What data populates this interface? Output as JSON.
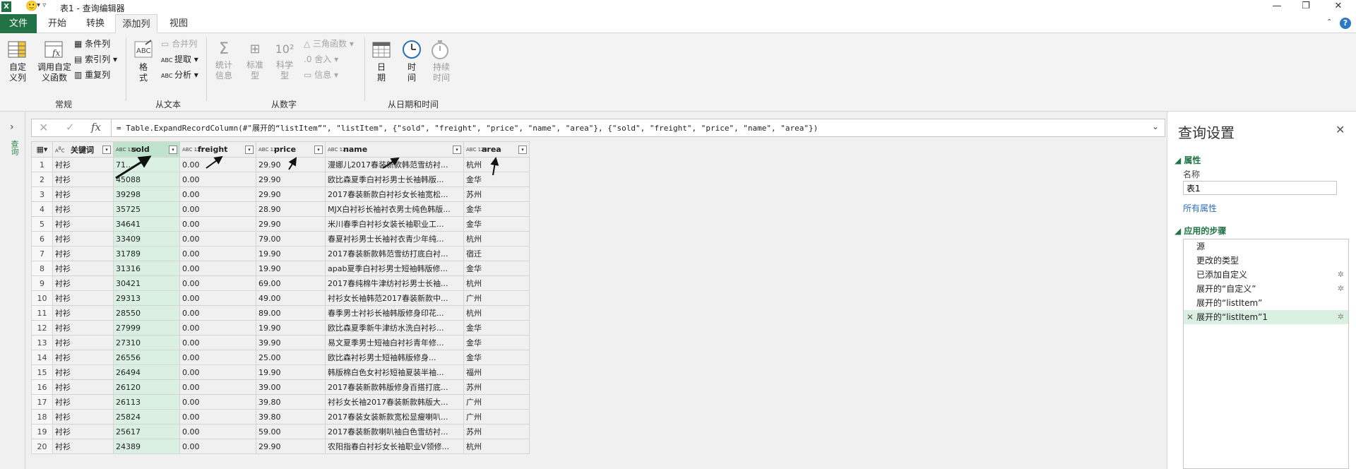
{
  "window": {
    "title": "表1 - 查询编辑器",
    "app_badge": "X",
    "smile": "🙂",
    "qat_arrows": "▾ ▿"
  },
  "tabs": [
    {
      "label": "文件"
    },
    {
      "label": "开始"
    },
    {
      "label": "转换"
    },
    {
      "label": "添加列"
    },
    {
      "label": "视图"
    }
  ],
  "ribbon": {
    "general": {
      "group_label": "常规",
      "custom_column": "自定\n义列",
      "invoke_custom_function": "调用自定\n义函数",
      "conditional_column": "条件列",
      "index_column": "索引列",
      "duplicate_column": "重复列"
    },
    "from_text": {
      "group_label": "从文本",
      "format": "格\n式",
      "merge_columns": "合并列",
      "extract": "提取",
      "parse": "分析"
    },
    "from_number": {
      "group_label": "从数字",
      "statistics": "统计\n信息",
      "standard": "标准\n型",
      "scientific": "科学\n型",
      "trig": "三角函数",
      "rounding": "舍入",
      "information": "信息"
    },
    "from_datetime": {
      "group_label": "从日期和时间",
      "date": "日\n期",
      "time": "时\n间",
      "duration": "持续\n时间"
    }
  },
  "left_pane": {
    "label": "查询"
  },
  "formula": {
    "text": "= Table.ExpandRecordColumn(#\"展开的“listItem”\", \"listItem\", {\"sold\", \"freight\", \"price\", \"name\", \"area\"}, {\"sold\", \"freight\", \"price\", \"name\", \"area\"})"
  },
  "grid": {
    "columns": [
      {
        "name": "关键词",
        "type": "ABC"
      },
      {
        "name": "sold",
        "type": "ABC123"
      },
      {
        "name": "freight",
        "type": "ABC123"
      },
      {
        "name": "price",
        "type": "ABC123"
      },
      {
        "name": "name",
        "type": "ABC123"
      },
      {
        "name": "area",
        "type": "ABC123"
      }
    ],
    "rows": [
      [
        "1",
        "衬衫",
        "71...",
        "0.00",
        "29.90",
        "漫娜儿2017春装新款韩范雪纺衬...",
        "杭州"
      ],
      [
        "2",
        "衬衫",
        "45088",
        "0.00",
        "29.90",
        "欧比森夏季白衬衫男士长袖韩版...",
        "金华"
      ],
      [
        "3",
        "衬衫",
        "39298",
        "0.00",
        "29.90",
        "2017春装新款白衬衫女长袖宽松...",
        "苏州"
      ],
      [
        "4",
        "衬衫",
        "35725",
        "0.00",
        "28.90",
        "MJX白衬衫长袖衬衣男士纯色韩版...",
        "金华"
      ],
      [
        "5",
        "衬衫",
        "34641",
        "0.00",
        "29.90",
        "米川春季白衬衫女装长袖职业工...",
        "金华"
      ],
      [
        "6",
        "衬衫",
        "33409",
        "0.00",
        "79.00",
        "春夏衬衫男士长袖衬衣青少年纯...",
        "杭州"
      ],
      [
        "7",
        "衬衫",
        "31789",
        "0.00",
        "19.90",
        "2017春装新款韩范雪纺打底白衬...",
        "宿迁"
      ],
      [
        "8",
        "衬衫",
        "31316",
        "0.00",
        "19.90",
        "apab夏季白衬衫男士短袖韩版修...",
        "金华"
      ],
      [
        "9",
        "衬衫",
        "30421",
        "0.00",
        "69.00",
        "2017春纯棉牛津纺衬衫男士长袖...",
        "杭州"
      ],
      [
        "10",
        "衬衫",
        "29313",
        "0.00",
        "49.00",
        "衬衫女长袖韩范2017春装新款中...",
        "广州"
      ],
      [
        "11",
        "衬衫",
        "28550",
        "0.00",
        "89.00",
        "春季男士衬衫长袖韩版修身印花...",
        "杭州"
      ],
      [
        "12",
        "衬衫",
        "27999",
        "0.00",
        "19.90",
        "欧比森夏季新牛津纺水洗白衬衫...",
        "金华"
      ],
      [
        "13",
        "衬衫",
        "27310",
        "0.00",
        "39.90",
        "易文夏季男士短袖白衬衫青年修...",
        "金华"
      ],
      [
        "14",
        "衬衫",
        "26556",
        "0.00",
        "25.00",
        "欧比森衬衫男士短袖韩版修身...",
        "金华"
      ],
      [
        "15",
        "衬衫",
        "26494",
        "0.00",
        "19.90",
        "韩版棉白色女衬衫短袖夏装半袖...",
        "福州"
      ],
      [
        "16",
        "衬衫",
        "26120",
        "0.00",
        "39.00",
        "2017春装新款韩版修身百搭打底...",
        "苏州"
      ],
      [
        "17",
        "衬衫",
        "26113",
        "0.00",
        "39.80",
        "衬衫女长袖2017春装新款韩版大...",
        "广州"
      ],
      [
        "18",
        "衬衫",
        "25824",
        "0.00",
        "39.80",
        "2017春装女装新款宽松显瘦喇叭...",
        "广州"
      ],
      [
        "19",
        "衬衫",
        "25617",
        "0.00",
        "59.00",
        "2017春装新款喇叭袖白色雪纺衬...",
        "苏州"
      ],
      [
        "20",
        "衬衫",
        "24389",
        "0.00",
        "29.90",
        "农阳指春白衬衫女长袖职业V领修...",
        "杭州"
      ]
    ]
  },
  "query_settings": {
    "title": "查询设置",
    "properties_header": "属性",
    "name_label": "名称",
    "name_value": "表1",
    "all_properties": "所有属性",
    "steps_header": "应用的步骤",
    "steps": [
      {
        "label": "源",
        "has_gear": false,
        "selected": false
      },
      {
        "label": "更改的类型",
        "has_gear": false,
        "selected": false
      },
      {
        "label": "已添加自定义",
        "has_gear": true,
        "selected": false
      },
      {
        "label": "展开的“自定义”",
        "has_gear": true,
        "selected": false
      },
      {
        "label": "展开的“listItem”",
        "has_gear": false,
        "selected": false
      },
      {
        "label": "展开的“listItem”1",
        "has_gear": true,
        "selected": true
      }
    ]
  },
  "colors": {
    "excel_green": "#217346",
    "selected_column": "#d9f0e2",
    "link_blue": "#2b6fb6"
  }
}
